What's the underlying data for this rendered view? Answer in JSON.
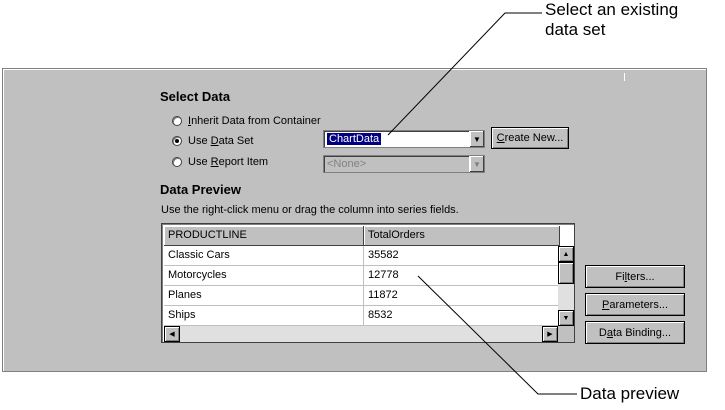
{
  "callouts": {
    "select_existing_line1": "Select an existing",
    "select_existing_line2": "data set",
    "data_preview": "Data preview"
  },
  "select_data": {
    "title": "Select Data",
    "options": [
      {
        "pre": "",
        "accel": "I",
        "post": "nherit Data from Container",
        "checked": false
      },
      {
        "pre": "Use ",
        "accel": "D",
        "post": "ata Set",
        "checked": true
      },
      {
        "pre": "Use ",
        "accel": "R",
        "post": "eport Item",
        "checked": false
      }
    ],
    "data_set_value": "ChartData",
    "report_item_value": "<None>",
    "create_new_pre": "",
    "create_new_accel": "C",
    "create_new_post": "reate New..."
  },
  "data_preview": {
    "title": "Data Preview",
    "hint": "Use the right-click menu or drag the column into series fields.",
    "columns": [
      "PRODUCTLINE",
      "TotalOrders"
    ],
    "rows": [
      [
        "Classic Cars",
        "35582"
      ],
      [
        "Motorcycles",
        "12778"
      ],
      [
        "Planes",
        "11872"
      ],
      [
        "Ships",
        "8532"
      ]
    ]
  },
  "side_buttons": [
    {
      "pre": "Fi",
      "accel": "l",
      "post": "ters..."
    },
    {
      "pre": "",
      "accel": "P",
      "post": "arameters..."
    },
    {
      "pre": "D",
      "accel": "a",
      "post": "ta Binding..."
    }
  ],
  "icons": {
    "dropdown": "chevron-down-icon",
    "scroll_up": "arrow-up-icon",
    "scroll_down": "arrow-down-icon",
    "scroll_left": "arrow-left-icon",
    "scroll_right": "arrow-right-icon"
  },
  "colors": {
    "panel_bg": "#c0c0c0",
    "selection": "#000080"
  }
}
